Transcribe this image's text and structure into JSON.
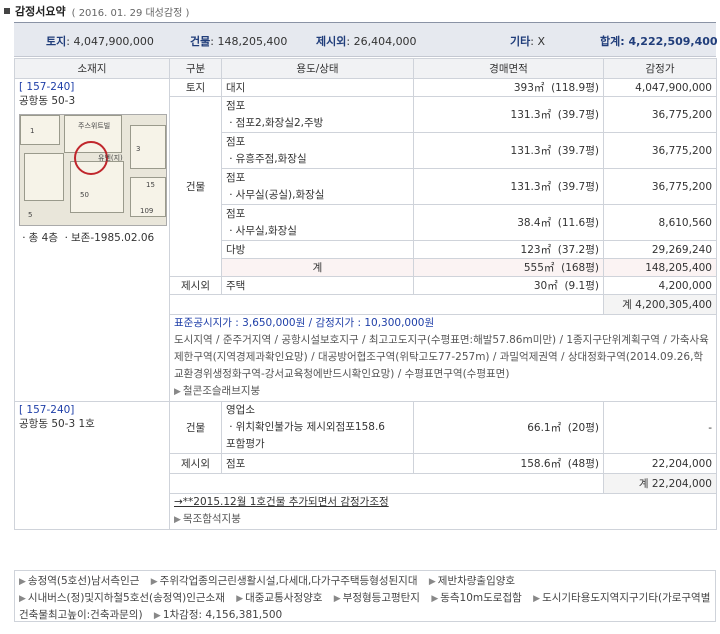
{
  "header": {
    "title": "감정서요약",
    "subtitle": "( 2016. 01. 29  대성감정 )"
  },
  "summary": {
    "land_label": "토지",
    "land_value": ": 4,047,900,000",
    "bldg_label": "건물",
    "bldg_value": ": 148,205,400",
    "excl_label": "제시외",
    "excl_value": ": 26,404,000",
    "etc_label": "기타",
    "etc_value": ": X",
    "total_label": "합계",
    "total_value": ": 4,222,509,400"
  },
  "table": {
    "headers": [
      "소재지",
      "구분",
      "용도/상태",
      "경매면적",
      "감정가"
    ],
    "p1": {
      "code": "[ 157-240]",
      "addr": "공항동 50-3",
      "meta": "ㆍ총 4층  ㆍ보존-1985.02.06",
      "land_cat": "토지",
      "land_use": "대지",
      "land_area": "393㎡",
      "land_py": "(118.9평)",
      "land_price": "4,047,900,000",
      "bldg_cat": "건물",
      "b1_a": "점포",
      "b1_b": "ㆍ점포2,화장실2,주방",
      "b1_area": "131.3㎡",
      "b1_py": "(39.7평)",
      "b1_price": "36,775,200",
      "b2_a": "점포",
      "b2_b": "ㆍ유흥주점,화장실",
      "b2_area": "131.3㎡",
      "b2_py": "(39.7평)",
      "b2_price": "36,775,200",
      "b3_a": "점포",
      "b3_b": "ㆍ사무실(공실),화장실",
      "b3_area": "131.3㎡",
      "b3_py": "(39.7평)",
      "b3_price": "36,775,200",
      "b4_a": "점포",
      "b4_b": "ㆍ사무실,화장실",
      "b4_area": "38.4㎡",
      "b4_py": "(11.6평)",
      "b4_price": "8,610,560",
      "b5_a": "다방",
      "b5_area": "123㎡",
      "b5_py": "(37.2평)",
      "b5_price": "29,269,240",
      "sum_lbl": "계",
      "sum_area": "555㎡",
      "sum_py": "(168평)",
      "sum_price": "148,205,400",
      "ex_cat": "제시외",
      "ex_use": "주택",
      "ex_area": "30㎡",
      "ex_py": "(9.1평)",
      "ex_price": "4,200,000",
      "total": "계  4,200,305,400",
      "pub_label": "표준공시지가 : 3,650,000원 / 감정지가 : 10,300,000원",
      "zones": "도시지역 / 준주거지역 / 공항시설보호지구 / 최고고도지구(수평표면:해발57.86m미만) / 1종지구단위계획구역 / 가축사육제한구역(지역경제과확인요망) / 대공방어협조구역(위탁고도77-257m) / 과밀억제권역 / 상대정화구역(2014.09.26,학교환경위생정화구역-강서교육청에반드시확인요망) / 수평표면구역(수평표면)",
      "link": "철콘조슬래브지붕"
    },
    "p2": {
      "code": "[ 157-240]",
      "addr": "공항동 50-3 1호",
      "bldg_cat": "건물",
      "b_a": "영업소",
      "b_b": "ㆍ위치확인불가능 제시외점포158.6",
      "b_c": "포함평가",
      "b_area": "66.1㎡",
      "b_py": "(20평)",
      "b_price": "-",
      "ex_cat": "제시외",
      "ex_use": "점포",
      "ex_area": "158.6㎡",
      "ex_py": "(48평)",
      "ex_price": "22,204,000",
      "total": "계  22,204,000",
      "note": "→**2015.12월 1호건물 추가되면서 감정가조정",
      "link": "목조함석지붕"
    }
  },
  "footer": {
    "items": [
      "송정역(5호선)남서측인근",
      "주위각업종의근린생활시설,다세대,다가구주택등형성된지대",
      "제반차량출입양호",
      "시내버스(정)및지하철5호선(송정역)인근소재",
      "대중교통사정양호",
      "부정형등고평탄지",
      "동측10m도로접함",
      "도시기타용도지역지구기타(가로구역별건축물최고높이:건축과문의)"
    ],
    "first_total": "1차감정: 4,156,381,500"
  },
  "map": {
    "labels": [
      "1",
      "주스위트빌",
      "유엔(지)",
      "50",
      "3",
      "15",
      "109",
      "5"
    ]
  }
}
